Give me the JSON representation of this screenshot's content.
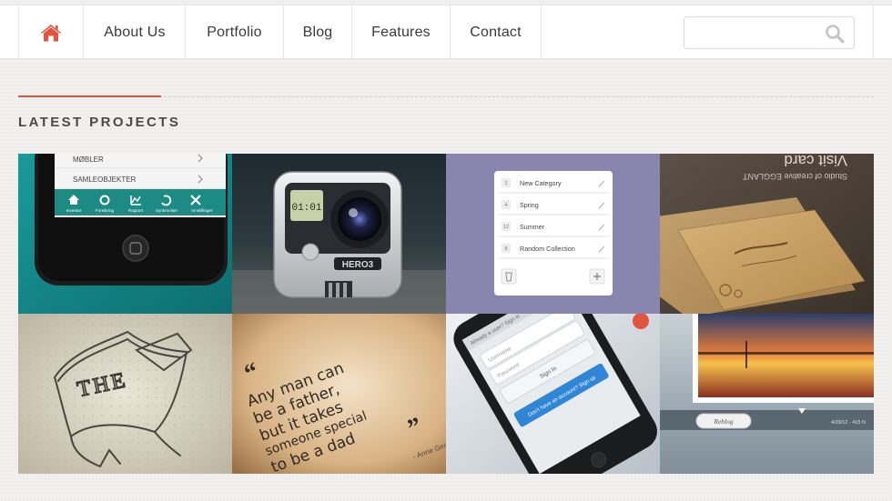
{
  "nav": {
    "items": [
      {
        "label": "About Us"
      },
      {
        "label": "Portfolio"
      },
      {
        "label": "Blog"
      },
      {
        "label": "Features"
      },
      {
        "label": "Contact"
      }
    ],
    "home_icon": "home-icon",
    "search": {
      "placeholder": "",
      "icon": "search-icon"
    }
  },
  "colors": {
    "accent": "#e0553f",
    "nav_text": "#3a3a3a"
  },
  "section": {
    "title": "LATEST PROJECTS"
  },
  "projects": {
    "tile1": {
      "menu_items": [
        "MØBLER",
        "SAMLEOBJEKTER"
      ],
      "tabs": [
        "Inventar",
        "Forsikring",
        "Rapport",
        "Synkroniser",
        "Innstillinger"
      ]
    },
    "tile2": {
      "screen_text": "01:01",
      "brand_text": "HERO3"
    },
    "tile3": {
      "rows": [
        {
          "count": "1",
          "label": "New Category"
        },
        {
          "count": "4",
          "label": "Spring"
        },
        {
          "count": "12",
          "label": "Summer"
        },
        {
          "count": "8",
          "label": "Random Collection"
        }
      ]
    },
    "tile4": {
      "heading": "Visit card",
      "subheading": "Studio of creative EGGLANT"
    },
    "tile5": {
      "sketch_text": "THE"
    },
    "tile6": {
      "quote_lines": [
        "Any man can",
        "be a father,",
        "but it takes",
        "someone special",
        "to be a dad"
      ],
      "author": "- Anne Geddes"
    },
    "tile7": {
      "header": "Already a user? Sign in",
      "fields": [
        "Username",
        "Password"
      ],
      "signin": "Sign In",
      "cta": "Don't have an account? Sign up"
    },
    "tile8": {
      "button": "Reblog",
      "meta": "4/29/12 · 415 N"
    }
  }
}
